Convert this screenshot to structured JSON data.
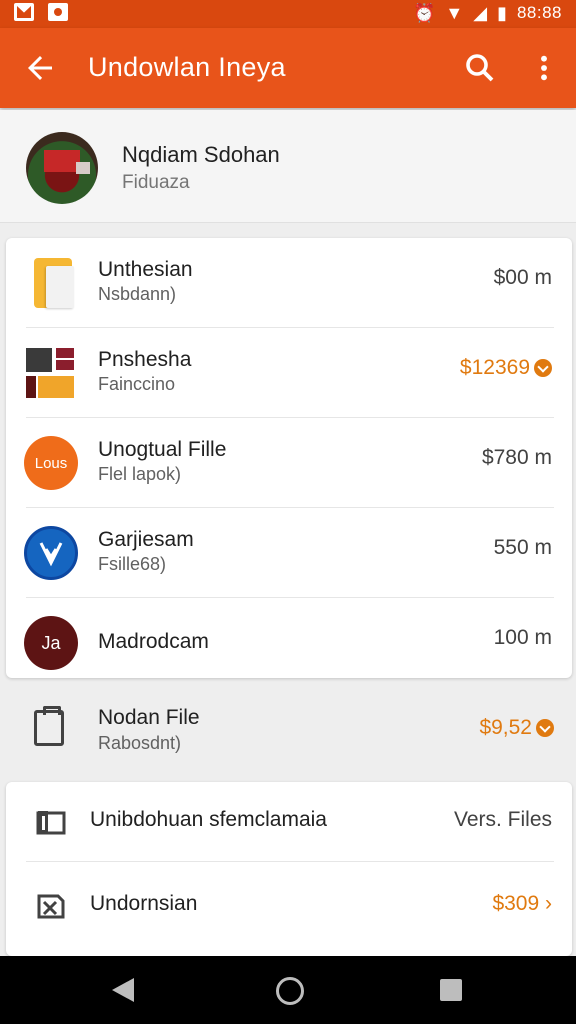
{
  "status_bar": {
    "time": "88:88",
    "icons": [
      "mail-icon",
      "camera-icon",
      "alarm-icon",
      "wifi-icon",
      "signal-icon",
      "battery-icon"
    ]
  },
  "app_bar": {
    "title": "Undowlan Ineya",
    "back_icon": "arrow-back-icon",
    "search_icon": "search-icon",
    "more_icon": "more-vert-icon",
    "color": "#e8541a"
  },
  "profile": {
    "name": "Nqdiam Sdohan",
    "subtitle": "Fiduaza"
  },
  "files": [
    {
      "title": "Unthesian",
      "subtitle": "Nsbdann)",
      "value": "$00 m",
      "accent": false,
      "icon": "folder-file-icon"
    },
    {
      "title": "Pnshesha",
      "subtitle": "Fainccino",
      "value": "$12369",
      "accent": true,
      "icon": "color-grid-icon"
    },
    {
      "title": "Unogtual Fille",
      "subtitle": "Flel lapok)",
      "value": "$780 m",
      "accent": false,
      "icon": "lous-logo-icon"
    },
    {
      "title": "Garjiesam",
      "subtitle": "Fsille68)",
      "value": "550 m",
      "accent": false,
      "icon": "blue-badge-icon"
    },
    {
      "title": "Madrodcam",
      "subtitle": "",
      "value": "100 m",
      "accent": false,
      "icon": "monogram-icon"
    }
  ],
  "standalone": {
    "title": "Nodan File",
    "subtitle": "Rabosdnt)",
    "value": "$9,52",
    "icon": "clipboard-icon"
  },
  "bottom_list": [
    {
      "label": "Unibdohuan sfemclamaia",
      "value": "Vers. Files",
      "accent": false,
      "icon": "folder-outline-icon"
    },
    {
      "label": "Undornsian",
      "value": "$309 ›",
      "accent": true,
      "icon": "inbox-icon"
    }
  ],
  "colors": {
    "accent": "#e07a10",
    "status_bar": "#d9480f"
  }
}
